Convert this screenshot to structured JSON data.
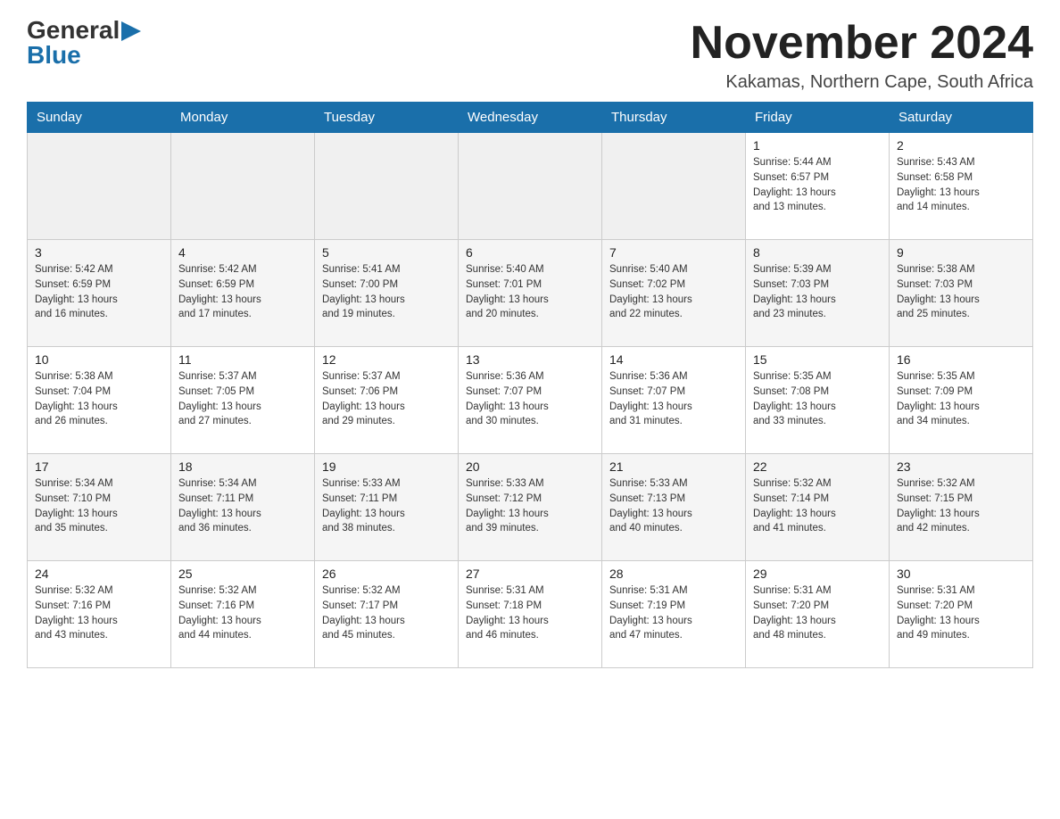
{
  "logo": {
    "general": "General",
    "blue": "Blue"
  },
  "title": "November 2024",
  "location": "Kakamas, Northern Cape, South Africa",
  "headers": [
    "Sunday",
    "Monday",
    "Tuesday",
    "Wednesday",
    "Thursday",
    "Friday",
    "Saturday"
  ],
  "weeks": [
    [
      {
        "day": "",
        "info": ""
      },
      {
        "day": "",
        "info": ""
      },
      {
        "day": "",
        "info": ""
      },
      {
        "day": "",
        "info": ""
      },
      {
        "day": "",
        "info": ""
      },
      {
        "day": "1",
        "info": "Sunrise: 5:44 AM\nSunset: 6:57 PM\nDaylight: 13 hours\nand 13 minutes."
      },
      {
        "day": "2",
        "info": "Sunrise: 5:43 AM\nSunset: 6:58 PM\nDaylight: 13 hours\nand 14 minutes."
      }
    ],
    [
      {
        "day": "3",
        "info": "Sunrise: 5:42 AM\nSunset: 6:59 PM\nDaylight: 13 hours\nand 16 minutes."
      },
      {
        "day": "4",
        "info": "Sunrise: 5:42 AM\nSunset: 6:59 PM\nDaylight: 13 hours\nand 17 minutes."
      },
      {
        "day": "5",
        "info": "Sunrise: 5:41 AM\nSunset: 7:00 PM\nDaylight: 13 hours\nand 19 minutes."
      },
      {
        "day": "6",
        "info": "Sunrise: 5:40 AM\nSunset: 7:01 PM\nDaylight: 13 hours\nand 20 minutes."
      },
      {
        "day": "7",
        "info": "Sunrise: 5:40 AM\nSunset: 7:02 PM\nDaylight: 13 hours\nand 22 minutes."
      },
      {
        "day": "8",
        "info": "Sunrise: 5:39 AM\nSunset: 7:03 PM\nDaylight: 13 hours\nand 23 minutes."
      },
      {
        "day": "9",
        "info": "Sunrise: 5:38 AM\nSunset: 7:03 PM\nDaylight: 13 hours\nand 25 minutes."
      }
    ],
    [
      {
        "day": "10",
        "info": "Sunrise: 5:38 AM\nSunset: 7:04 PM\nDaylight: 13 hours\nand 26 minutes."
      },
      {
        "day": "11",
        "info": "Sunrise: 5:37 AM\nSunset: 7:05 PM\nDaylight: 13 hours\nand 27 minutes."
      },
      {
        "day": "12",
        "info": "Sunrise: 5:37 AM\nSunset: 7:06 PM\nDaylight: 13 hours\nand 29 minutes."
      },
      {
        "day": "13",
        "info": "Sunrise: 5:36 AM\nSunset: 7:07 PM\nDaylight: 13 hours\nand 30 minutes."
      },
      {
        "day": "14",
        "info": "Sunrise: 5:36 AM\nSunset: 7:07 PM\nDaylight: 13 hours\nand 31 minutes."
      },
      {
        "day": "15",
        "info": "Sunrise: 5:35 AM\nSunset: 7:08 PM\nDaylight: 13 hours\nand 33 minutes."
      },
      {
        "day": "16",
        "info": "Sunrise: 5:35 AM\nSunset: 7:09 PM\nDaylight: 13 hours\nand 34 minutes."
      }
    ],
    [
      {
        "day": "17",
        "info": "Sunrise: 5:34 AM\nSunset: 7:10 PM\nDaylight: 13 hours\nand 35 minutes."
      },
      {
        "day": "18",
        "info": "Sunrise: 5:34 AM\nSunset: 7:11 PM\nDaylight: 13 hours\nand 36 minutes."
      },
      {
        "day": "19",
        "info": "Sunrise: 5:33 AM\nSunset: 7:11 PM\nDaylight: 13 hours\nand 38 minutes."
      },
      {
        "day": "20",
        "info": "Sunrise: 5:33 AM\nSunset: 7:12 PM\nDaylight: 13 hours\nand 39 minutes."
      },
      {
        "day": "21",
        "info": "Sunrise: 5:33 AM\nSunset: 7:13 PM\nDaylight: 13 hours\nand 40 minutes."
      },
      {
        "day": "22",
        "info": "Sunrise: 5:32 AM\nSunset: 7:14 PM\nDaylight: 13 hours\nand 41 minutes."
      },
      {
        "day": "23",
        "info": "Sunrise: 5:32 AM\nSunset: 7:15 PM\nDaylight: 13 hours\nand 42 minutes."
      }
    ],
    [
      {
        "day": "24",
        "info": "Sunrise: 5:32 AM\nSunset: 7:16 PM\nDaylight: 13 hours\nand 43 minutes."
      },
      {
        "day": "25",
        "info": "Sunrise: 5:32 AM\nSunset: 7:16 PM\nDaylight: 13 hours\nand 44 minutes."
      },
      {
        "day": "26",
        "info": "Sunrise: 5:32 AM\nSunset: 7:17 PM\nDaylight: 13 hours\nand 45 minutes."
      },
      {
        "day": "27",
        "info": "Sunrise: 5:31 AM\nSunset: 7:18 PM\nDaylight: 13 hours\nand 46 minutes."
      },
      {
        "day": "28",
        "info": "Sunrise: 5:31 AM\nSunset: 7:19 PM\nDaylight: 13 hours\nand 47 minutes."
      },
      {
        "day": "29",
        "info": "Sunrise: 5:31 AM\nSunset: 7:20 PM\nDaylight: 13 hours\nand 48 minutes."
      },
      {
        "day": "30",
        "info": "Sunrise: 5:31 AM\nSunset: 7:20 PM\nDaylight: 13 hours\nand 49 minutes."
      }
    ]
  ]
}
